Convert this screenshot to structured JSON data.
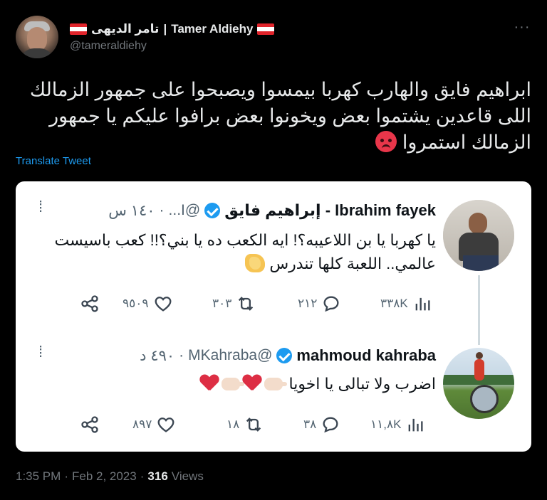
{
  "author": {
    "name_ar": "تامر الديهى",
    "separator": "|",
    "name_en": "Tamer Aldiehy",
    "handle": "@tameraldiehy"
  },
  "tweet": {
    "text": "ابراهيم فايق والهارب كهربا بيمسوا ويصبحوا على جمهور الزمالك اللى قاعدين يشتموا بعض ويخونوا بعض برافوا عليكم يا جمهور الزمالك استمروا",
    "translate_label": "Translate Tweet",
    "time": "1:35 PM",
    "date": "Feb 2, 2023",
    "views_count": "316",
    "views_label": "Views",
    "dot": "·"
  },
  "quoted": [
    {
      "name": "Ibrahim fayek - إبراهيم فايق",
      "handle": "@I...",
      "time": "١٤٠ س",
      "text": "يا كهربا يا بن اللاعيبه؟! ايه الكعب ده يا بني؟!! كعب باسيست عالمي.. اللعبة كلها تندرس",
      "actions": {
        "views": "٣٣٨K",
        "replies": "٢١٢",
        "retweets": "٣٠٣",
        "likes": "٩٥٠٩"
      },
      "action_icons": [
        "views-icon",
        "reply-icon",
        "retweet-icon",
        "like-icon",
        "share-icon"
      ]
    },
    {
      "name": "mahmoud kahraba",
      "handle": "@MKahraba",
      "time": "٤٩٠ د",
      "text": "اضرب ولا تبالى يا اخويا",
      "actions": {
        "views": "١١,٨K",
        "replies": "٣٨",
        "retweets": "١٨",
        "likes": "٨٩٧"
      },
      "action_icons": [
        "views-icon",
        "reply-icon",
        "retweet-icon",
        "like-icon",
        "share-icon"
      ]
    }
  ],
  "colors": {
    "background": "#000000",
    "link": "#1d9bf0",
    "verified": "#1d9bf0",
    "muted": "#71767b",
    "card": "#ffffff"
  }
}
